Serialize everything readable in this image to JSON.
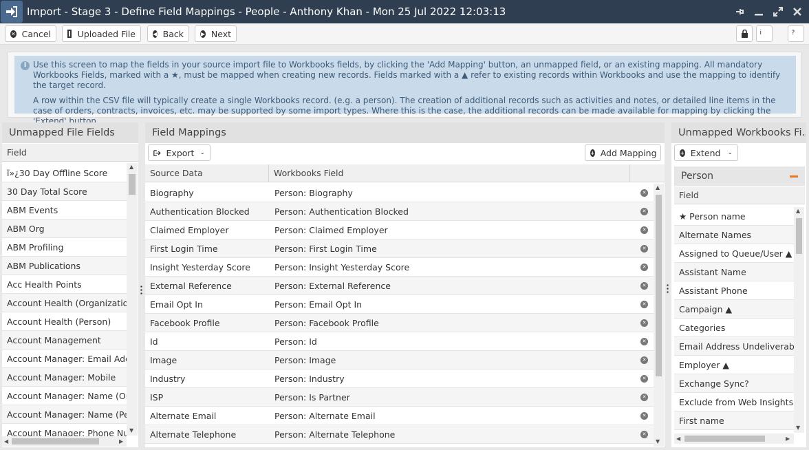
{
  "window": {
    "title": "Import - Stage 3 - Define Field Mappings - People - Anthony Khan - Mon 25 Jul 2022 12:03:13"
  },
  "toolbar": {
    "cancel": "Cancel",
    "uploaded": "Uploaded File",
    "back": "Back",
    "next": "Next"
  },
  "info": {
    "p1": "Use this screen to map the fields in your source import file to Workbooks fields, by clicking the 'Add Mapping' button, an unmapped field, or an existing mapping. All mandatory Workbooks Fields, marked with a ★, must be mapped when creating new records. Fields marked with a ▲ refer to existing records within Workbooks and use the mapping to identify the target record.",
    "p2": "A row within the CSV file will typically create a single Workbooks record. (e.g. a person). The creation of additional records such as activities and notes, or detailed line items in the case of orders, contracts, invoices, etc. may be supported by some import types. Where this is the case, the additional records can be made available for mapping by clicking the 'Extend' button."
  },
  "left": {
    "title": "Unmapped File Fields",
    "col": "Field",
    "items": [
      "ï»¿30 Day Offline Score",
      "30 Day Total Score",
      "ABM Events",
      "ABM Org",
      "ABM Profiling",
      "ABM Publications",
      "Acc Health Points",
      "Account Health (Organization)",
      "Account Health (Person)",
      "Account Management",
      "Account Manager: Email Address",
      "Account Manager: Mobile",
      "Account Manager: Name (Organization)",
      "Account Manager: Name (Person)",
      "Account Manager: Phone Number"
    ]
  },
  "mid": {
    "title": "Field Mappings",
    "export": "Export",
    "add": "Add Mapping",
    "col1": "Source Data",
    "col2": "Workbooks Field",
    "rows": [
      {
        "src": "Biography",
        "dst": "Person: Biography"
      },
      {
        "src": "Authentication Blocked",
        "dst": "Person: Authentication Blocked"
      },
      {
        "src": "Claimed Employer",
        "dst": "Person: Claimed Employer"
      },
      {
        "src": "First Login Time",
        "dst": "Person: First Login Time"
      },
      {
        "src": "Insight Yesterday Score",
        "dst": "Person: Insight Yesterday Score"
      },
      {
        "src": "External Reference",
        "dst": "Person: External Reference"
      },
      {
        "src": "Email Opt In",
        "dst": "Person: Email Opt In"
      },
      {
        "src": "Facebook Profile",
        "dst": "Person: Facebook Profile"
      },
      {
        "src": "Id",
        "dst": "Person: Id"
      },
      {
        "src": "Image",
        "dst": "Person: Image"
      },
      {
        "src": "Industry",
        "dst": "Person: Industry"
      },
      {
        "src": "ISP",
        "dst": "Person: Is Partner"
      },
      {
        "src": "Alternate Email",
        "dst": "Person: Alternate Email"
      },
      {
        "src": "Alternate Telephone",
        "dst": "Person: Alternate Telephone"
      }
    ]
  },
  "right": {
    "title": "Unmapped Workbooks Fi...",
    "extend": "Extend",
    "group": "Person",
    "col": "Field",
    "items": [
      "★ Person name",
      "Alternate Names",
      "Assigned to Queue/User ▲",
      "Assistant Name",
      "Assistant Phone",
      "Campaign ▲",
      "Categories",
      "Email Address Undeliverable",
      "Employer ▲",
      "Exchange Sync?",
      "Exclude from Web Insights",
      "First name"
    ]
  }
}
